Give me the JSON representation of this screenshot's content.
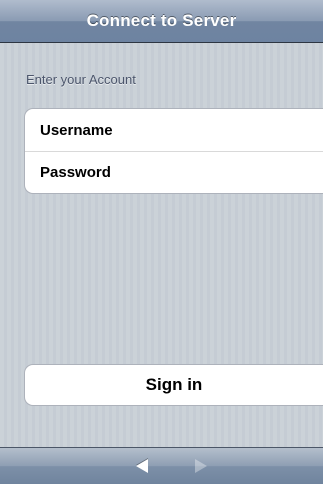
{
  "nav_bar": {
    "title": "Connect to Server"
  },
  "account_section": {
    "header": "Enter your Account",
    "fields": [
      {
        "label": "Username"
      },
      {
        "label": "Password"
      }
    ]
  },
  "sign_in": {
    "label": "Sign in"
  },
  "toolbar": {
    "back_icon": "back-arrow-icon",
    "forward_icon": "forward-arrow-icon",
    "forward_enabled": false
  },
  "colors": {
    "nav_bar": "#7185a1",
    "background": "#c5ccd4",
    "section_header_text": "#4c566c",
    "cell_background": "#ffffff"
  }
}
